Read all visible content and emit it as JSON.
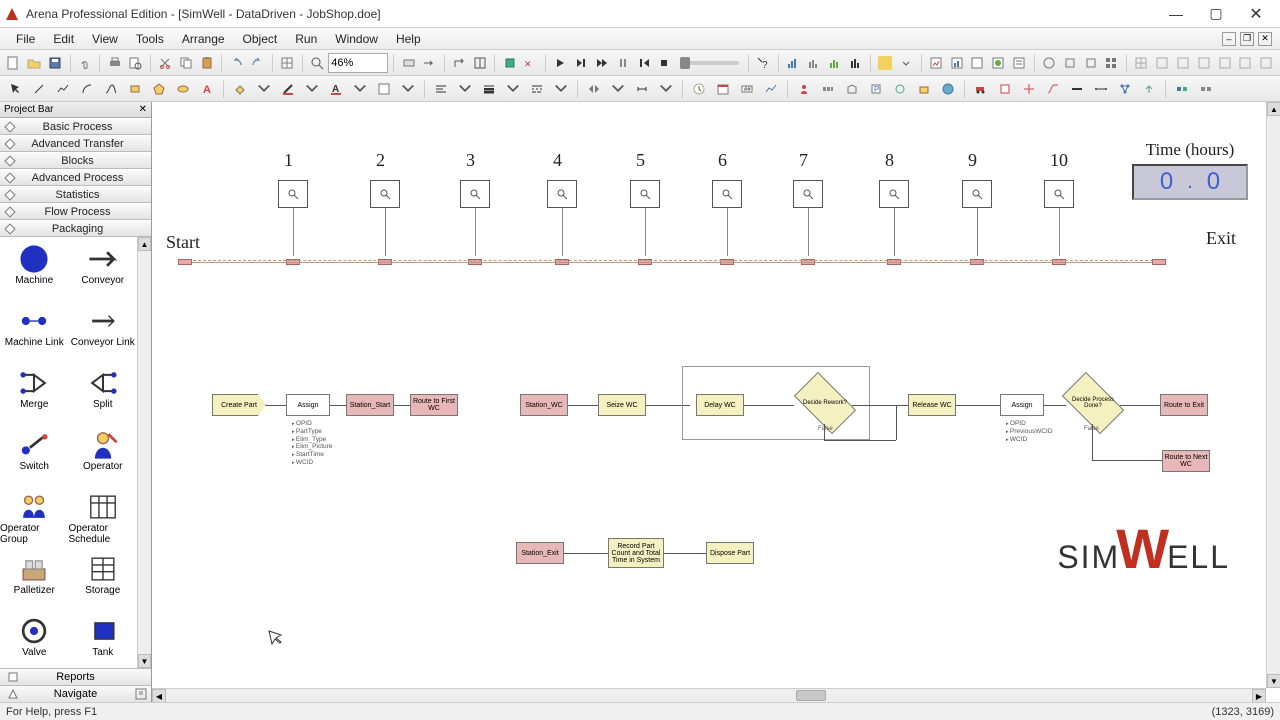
{
  "title": "Arena Professional Edition - [SimWell - DataDriven - JobShop.doe]",
  "menu": [
    "File",
    "Edit",
    "View",
    "Tools",
    "Arrange",
    "Object",
    "Run",
    "Window",
    "Help"
  ],
  "zoom": "46%",
  "projectbar": {
    "header": "Project Bar",
    "categories": [
      "Basic Process",
      "Advanced Transfer",
      "Blocks",
      "Advanced Process",
      "Statistics",
      "Flow Process",
      "Packaging"
    ],
    "footer": [
      "Reports",
      "Navigate"
    ]
  },
  "palette": [
    {
      "name": "Machine"
    },
    {
      "name": "Conveyor"
    },
    {
      "name": "Machine Link"
    },
    {
      "name": "Conveyor Link"
    },
    {
      "name": "Merge"
    },
    {
      "name": "Split"
    },
    {
      "name": "Switch"
    },
    {
      "name": "Operator"
    },
    {
      "name": "Operator Group"
    },
    {
      "name": "Operator Schedule"
    },
    {
      "name": "Palletizer"
    },
    {
      "name": "Storage"
    },
    {
      "name": "Valve"
    },
    {
      "name": "Tank"
    }
  ],
  "stations": [
    "1",
    "2",
    "3",
    "4",
    "5",
    "6",
    "7",
    "8",
    "9",
    "10"
  ],
  "labels": {
    "start": "Start",
    "exit": "Exit"
  },
  "time": {
    "title": "Time (hours)",
    "left": "0",
    "right": "0"
  },
  "blocks": {
    "createPart": "Create Part",
    "assign1": "Assign",
    "stationStart": "Station_Start",
    "routeFirst": "Route to First WC",
    "stationWC": "Station_WC",
    "seizeWC": "Seize WC",
    "delayWC": "Delay WC",
    "decideRework": "Decide Rework?",
    "releaseWC": "Release WC",
    "assign2": "Assign",
    "decideDone": "Decide Process Done?",
    "routeExit": "Route to Exit",
    "routeNext": "Route to Next WC",
    "stationExit": "Station_Exit",
    "record": "Record Part Count and Total Time in System",
    "dispose": "Dispose Part"
  },
  "anno1": [
    "OPID",
    "PartType",
    "Elim_Type",
    "Elim_Picture",
    "StartTime",
    "WCID"
  ],
  "anno2": [
    "OPID",
    "PreviousWCID",
    "WCID"
  ],
  "anno3": "False",
  "logo": "SIMWELL",
  "status": {
    "help": "For Help, press F1",
    "coords": "(1323, 3169)"
  }
}
